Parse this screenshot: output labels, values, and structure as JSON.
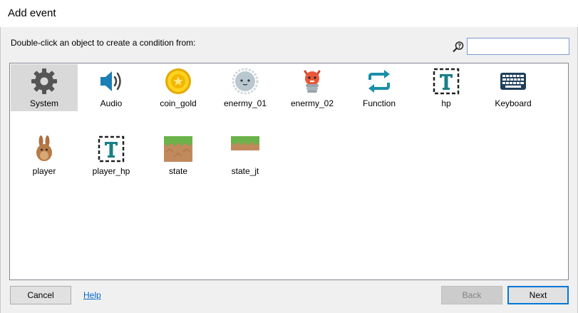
{
  "window": {
    "title": "Add event"
  },
  "dialog": {
    "prompt": "Double-click an object to create a condition from:",
    "search": {
      "value": "",
      "placeholder": "",
      "icon": "search-icon"
    }
  },
  "objects": [
    {
      "label": "System",
      "icon": "gear-icon",
      "selected": true
    },
    {
      "label": "Audio",
      "icon": "speaker-icon",
      "selected": false
    },
    {
      "label": "coin_gold",
      "icon": "coin-icon",
      "selected": false
    },
    {
      "label": "enermy_01",
      "icon": "enemy-ghost-icon",
      "selected": false
    },
    {
      "label": "enermy_02",
      "icon": "enemy-robot-icon",
      "selected": false
    },
    {
      "label": "Function",
      "icon": "function-arrows-icon",
      "selected": false
    },
    {
      "label": "hp",
      "icon": "text-object-icon",
      "selected": false
    },
    {
      "label": "Keyboard",
      "icon": "keyboard-icon",
      "selected": false
    },
    {
      "label": "player",
      "icon": "bunny-icon",
      "selected": false
    },
    {
      "label": "player_hp",
      "icon": "text-object-icon",
      "selected": false
    },
    {
      "label": "state",
      "icon": "grass-tile-icon",
      "selected": false
    },
    {
      "label": "state_jt",
      "icon": "grass-strip-icon",
      "selected": false
    }
  ],
  "buttons": {
    "cancel": "Cancel",
    "help": "Help",
    "back": "Back",
    "next": "Next"
  },
  "colors": {
    "selection": "#d9d9d9",
    "link": "#0066cc",
    "accent": "#0078d7"
  }
}
